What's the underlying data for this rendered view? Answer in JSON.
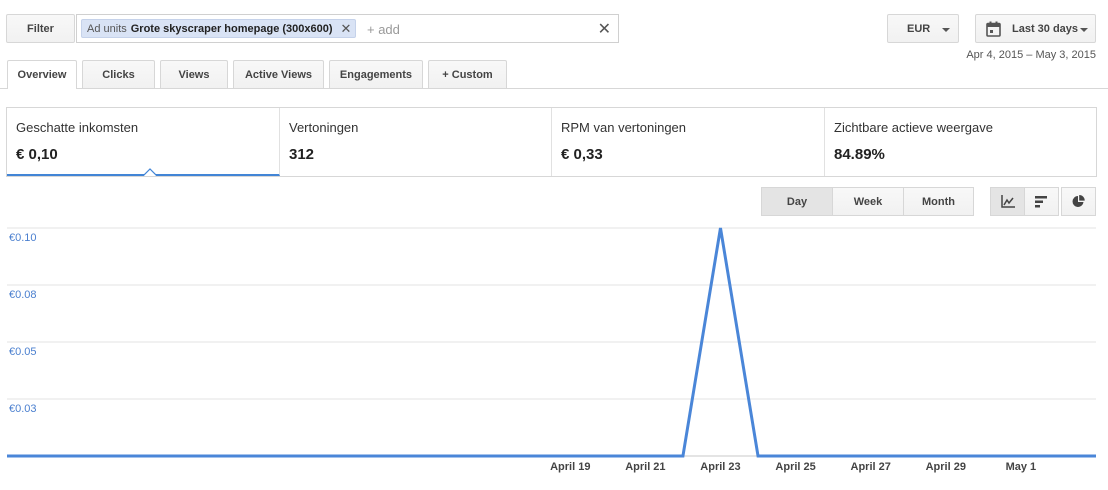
{
  "filter": {
    "button_label": "Filter",
    "chip_prefix": "Ad units",
    "chip_value": "Grote skyscraper homepage (300x600)",
    "add_placeholder": "+ add"
  },
  "currency": {
    "label": "EUR"
  },
  "date_picker": {
    "label": "Last 30 days",
    "range": "Apr 4, 2015 – May 3, 2015"
  },
  "tabs": [
    {
      "label": "Overview"
    },
    {
      "label": "Clicks"
    },
    {
      "label": "Views"
    },
    {
      "label": "Active Views"
    },
    {
      "label": "Engagements"
    },
    {
      "label": "+  Custom"
    }
  ],
  "scorecards": [
    {
      "label": "Geschatte inkomsten",
      "value": "€ 0,10"
    },
    {
      "label": "Vertoningen",
      "value": "312"
    },
    {
      "label": "RPM van vertoningen",
      "value": "€ 0,33"
    },
    {
      "label": "Zichtbare actieve weergave",
      "value": "84.89%"
    }
  ],
  "granularity": {
    "day": "Day",
    "week": "Week",
    "month": "Month",
    "selected": "Day"
  },
  "chart_types": [
    "line-chart-icon",
    "bar-chart-icon",
    "pie-chart-icon"
  ],
  "colors": {
    "series": "#4a86d8",
    "accent": "#4285d6"
  },
  "chart_data": {
    "type": "line",
    "title": "",
    "xlabel": "",
    "ylabel": "",
    "x": [
      "Apr 4",
      "Apr 5",
      "Apr 6",
      "Apr 7",
      "Apr 8",
      "Apr 9",
      "Apr 10",
      "Apr 11",
      "Apr 12",
      "Apr 13",
      "Apr 14",
      "Apr 15",
      "Apr 16",
      "Apr 17",
      "Apr 18",
      "Apr 19",
      "Apr 20",
      "Apr 21",
      "Apr 22",
      "Apr 23",
      "Apr 24",
      "Apr 25",
      "Apr 26",
      "Apr 27",
      "Apr 28",
      "Apr 29",
      "Apr 30",
      "May 1",
      "May 2",
      "May 3"
    ],
    "series": [
      {
        "values": [
          0,
          0,
          0,
          0,
          0,
          0,
          0,
          0,
          0,
          0,
          0,
          0,
          0,
          0,
          0,
          0,
          0,
          0,
          0,
          0.1,
          0,
          0,
          0,
          0,
          0,
          0,
          0,
          0,
          0,
          0
        ]
      }
    ],
    "x_ticks": [
      "April 19",
      "April 21",
      "April 23",
      "April 25",
      "April 27",
      "April 29",
      "May 1"
    ],
    "y_ticks": [
      "€0.03",
      "€0.05",
      "€0.08",
      "€0.10"
    ],
    "ylim": [
      0,
      0.1
    ],
    "grid": true
  }
}
